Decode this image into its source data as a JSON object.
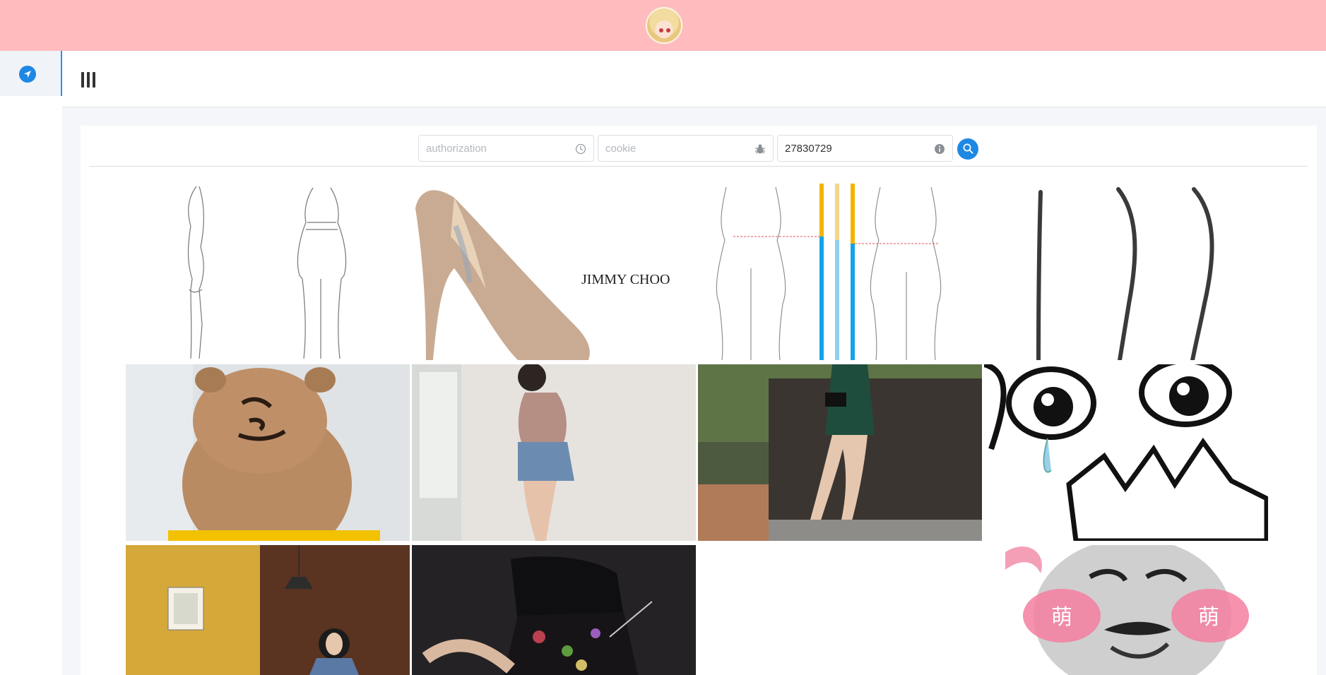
{
  "header": {
    "avatar_icon": "anime-avatar-icon"
  },
  "sidebar": {
    "items": [
      {
        "icon": "navigation-arrow-icon",
        "active": true
      }
    ]
  },
  "toolbar": {
    "menu_icon": "menu-bars-icon"
  },
  "search": {
    "authorization": {
      "value": "",
      "placeholder": "authorization",
      "icon": "clock-icon"
    },
    "cookie": {
      "value": "",
      "placeholder": "cookie",
      "icon": "bug-icon"
    },
    "id": {
      "value": "27830729",
      "placeholder": "",
      "icon": "info-icon"
    },
    "button_icon": "search-icon"
  },
  "gallery": {
    "rows": [
      [
        "body-sketch-image",
        "jimmy-choo-heel-image",
        "body-proportion-chart-image",
        "curve-lines-image"
      ],
      [
        "bear-meme-image",
        "woman-denim-shorts-image",
        "woman-green-dress-image",
        "crying-rage-face-image"
      ],
      [
        "woman-cafe-image",
        "woman-floral-skirt-image",
        "",
        "panda-meme-image"
      ]
    ],
    "heel_brand_text": "JIMMY CHOO",
    "panda_blush_text": [
      "萌",
      "萌"
    ]
  },
  "colors": {
    "topbar": "#ffbbbd",
    "accent": "#1e88e5",
    "background": "#f4f6f9"
  }
}
